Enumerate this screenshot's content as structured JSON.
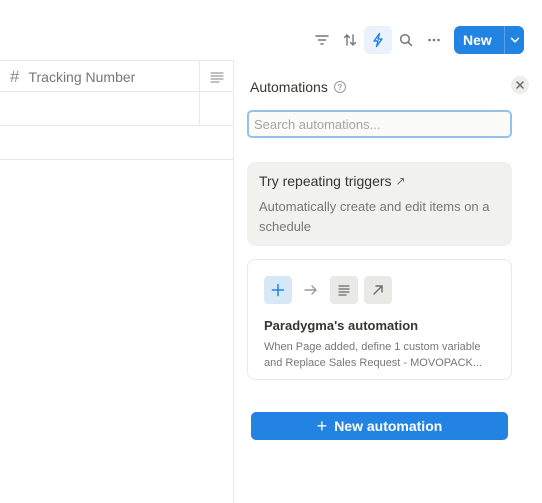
{
  "toolbar": {
    "new_label": "New",
    "icons": [
      "filter-icon",
      "sort-icon",
      "automation-lightning-icon",
      "search-icon",
      "more-icon"
    ]
  },
  "table": {
    "column_header": "Tracking Number",
    "column_type_icon": "hash-icon"
  },
  "panel": {
    "title": "Automations",
    "search_placeholder": "Search automations...",
    "promo": {
      "title": "Try repeating triggers",
      "title_arrow": "↗",
      "description": "Automatically create and edit items on a schedule"
    },
    "automation_card": {
      "title": "Paradygma's automation",
      "description_line1": "When Page added, define 1 custom variable",
      "description_line2": "and Replace Sales Request - MOVOPACK..."
    },
    "new_automation_label": "New automation"
  },
  "colors": {
    "accent": "#2383e2",
    "active_icon_bg": "#eaf3fb",
    "promo_bg": "#f1f1ef"
  }
}
